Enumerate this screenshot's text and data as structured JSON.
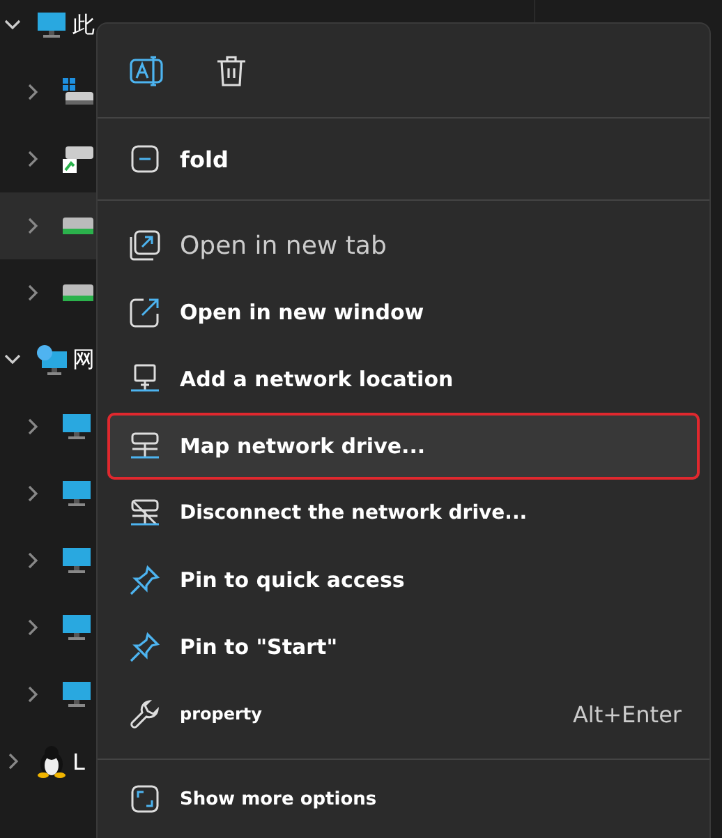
{
  "tree": [
    {
      "label": "此",
      "expanded": true,
      "selected": false,
      "children": [
        {
          "expanded": false,
          "selected": false
        },
        {
          "expanded": false,
          "selected": false
        },
        {
          "expanded": false,
          "selected": true
        },
        {
          "expanded": false,
          "selected": false
        }
      ]
    },
    {
      "label": "网",
      "expanded": true,
      "selected": false,
      "children": [
        {
          "expanded": false,
          "selected": false
        },
        {
          "expanded": false,
          "selected": false
        },
        {
          "expanded": false,
          "selected": false
        },
        {
          "expanded": false,
          "selected": false
        },
        {
          "expanded": false,
          "selected": false
        }
      ]
    },
    {
      "label": "L",
      "expanded": false,
      "selected": false
    }
  ],
  "menu": {
    "fold": {
      "label": "fold"
    },
    "items": [
      {
        "label": "Open in new tab",
        "hovered": false,
        "outlined": false
      },
      {
        "label": "Open in new window",
        "hovered": false,
        "outlined": false
      },
      {
        "label": "Add a network location",
        "hovered": false,
        "outlined": false
      },
      {
        "label": "Map network drive...",
        "hovered": true,
        "outlined": true
      },
      {
        "label": "Disconnect the network drive...",
        "hovered": false,
        "outlined": false
      },
      {
        "label": "Pin to quick access",
        "hovered": false,
        "outlined": false
      },
      {
        "label": "Pin to \"Start\"",
        "hovered": false,
        "outlined": false
      },
      {
        "label": "property",
        "shortcut": "Alt+Enter",
        "hovered": false,
        "outlined": false
      }
    ],
    "footer": {
      "label": "Show more options"
    }
  }
}
